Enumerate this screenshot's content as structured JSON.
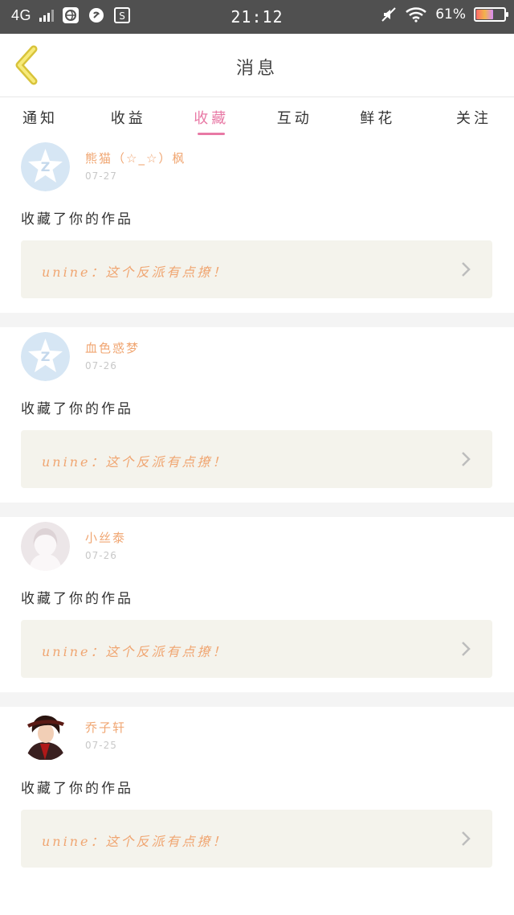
{
  "status_bar": {
    "network": "4G",
    "time": "21:12",
    "battery": "61%",
    "battery_level": 0.61
  },
  "header": {
    "title": "消息",
    "back_icon": "chevron-left-icon"
  },
  "tabs": [
    {
      "label": "通知",
      "active": false
    },
    {
      "label": "收益",
      "active": false
    },
    {
      "label": "收藏",
      "active": true
    },
    {
      "label": "互动",
      "active": false
    },
    {
      "label": "鲜花",
      "active": false
    },
    {
      "label": "关注",
      "active": false
    }
  ],
  "accent_color": "#e879a5",
  "name_color": "#f0a672",
  "items": [
    {
      "name": "熊猫（☆_☆）枫",
      "date": "07-27",
      "action": "收藏了你的作品",
      "quote": "unine：这个反派有点撩！",
      "avatar": "qq-default-avatar"
    },
    {
      "name": "血色惑梦",
      "date": "07-26",
      "action": "收藏了你的作品",
      "quote": "unine：这个反派有点撩！",
      "avatar": "qq-default-avatar"
    },
    {
      "name": "小丝泰",
      "date": "07-26",
      "action": "收藏了你的作品",
      "quote": "unine：这个反派有点撩！",
      "avatar": "silhouette-avatar"
    },
    {
      "name": "乔子轩",
      "date": "07-25",
      "action": "收藏了你的作品",
      "quote": "unine：这个反派有点撩！",
      "avatar": "photo-avatar"
    }
  ]
}
